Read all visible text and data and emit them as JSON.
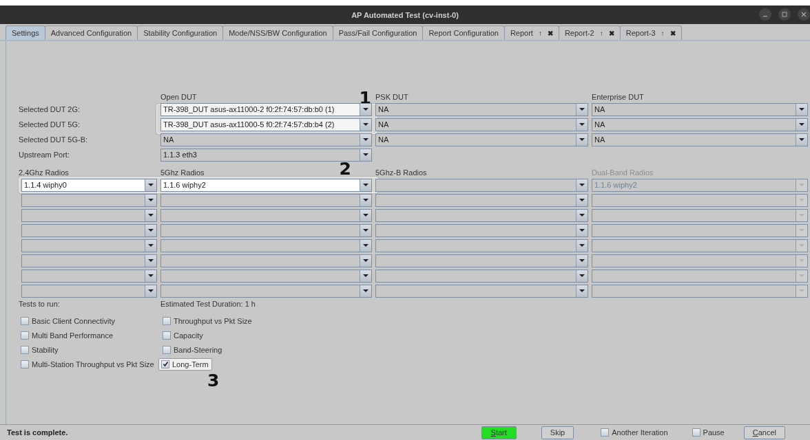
{
  "window": {
    "title": "AP Automated Test  (cv-inst-0)"
  },
  "tabs": [
    {
      "label": "Settings",
      "selected": true
    },
    {
      "label": "Advanced Configuration",
      "selected": false
    },
    {
      "label": "Stability Configuration",
      "selected": false
    },
    {
      "label": "Mode/NSS/BW Configuration",
      "selected": false
    },
    {
      "label": "Pass/Fail Configuration",
      "selected": false
    },
    {
      "label": "Report Configuration",
      "selected": false
    },
    {
      "label": "Report",
      "selected": false,
      "controls": [
        "↑",
        "✖"
      ]
    },
    {
      "label": "Report-2",
      "selected": false,
      "controls": [
        "↑",
        "✖"
      ]
    },
    {
      "label": "Report-3",
      "selected": false,
      "controls": [
        "↑",
        "✖"
      ]
    }
  ],
  "dut": {
    "columns": [
      "Open DUT",
      "PSK DUT",
      "Enterprise DUT"
    ],
    "rows": [
      {
        "label": "Selected DUT 2G:",
        "fields": [
          {
            "value": "TR-398_DUT asus-ax11000-2 f0:2f:74:57:db:b0 (1)",
            "highlighted": true
          },
          {
            "value": "NA"
          },
          {
            "value": "NA"
          }
        ]
      },
      {
        "label": "Selected DUT 5G:",
        "fields": [
          {
            "value": "TR-398_DUT asus-ax11000-5 f0:2f:74:57:db:b4 (2)",
            "highlighted": true
          },
          {
            "value": "NA"
          },
          {
            "value": "NA"
          }
        ]
      },
      {
        "label": "Selected DUT 5G-B:",
        "fields": [
          {
            "value": "NA"
          },
          {
            "value": "NA"
          },
          {
            "value": "NA"
          }
        ]
      },
      {
        "label": "Upstream Port:",
        "fields": [
          {
            "value": "1.1.3 eth3"
          }
        ]
      }
    ],
    "callout": "1"
  },
  "radios": {
    "columns": [
      {
        "label": "2.4Ghz Radios",
        "disabled": false
      },
      {
        "label": "5Ghz Radios",
        "disabled": false
      },
      {
        "label": "5Ghz-B Radios",
        "disabled": false
      },
      {
        "label": "Dual-Band Radios",
        "disabled": true
      }
    ],
    "rows": [
      [
        {
          "value": "1.1.4 wiphy0",
          "highlighted": true
        },
        {
          "value": "1.1.6 wiphy2",
          "highlighted": true
        },
        {},
        {
          "value": "1.1.6 wiphy2"
        }
      ],
      [
        {},
        {},
        {},
        {}
      ],
      [
        {},
        {},
        {},
        {}
      ],
      [
        {},
        {},
        {},
        {}
      ],
      [
        {},
        {},
        {},
        {}
      ],
      [
        {},
        {},
        {},
        {}
      ],
      [
        {},
        {},
        {},
        {}
      ],
      [
        {},
        {},
        {},
        {}
      ]
    ],
    "callout": "2"
  },
  "tests": {
    "label": "Tests to run:",
    "duration": "Estimated Test Duration: 1 h",
    "items": [
      {
        "label": "Basic Client Connectivity",
        "checked": false
      },
      {
        "label": "Throughput vs Pkt Size",
        "checked": false
      },
      {
        "label": "Multi Band Performance",
        "checked": false
      },
      {
        "label": "Capacity",
        "checked": false
      },
      {
        "label": "Stability",
        "checked": false
      },
      {
        "label": "Band-Steering",
        "checked": false
      },
      {
        "label": "Multi-Station Throughput vs Pkt Size",
        "checked": false
      },
      {
        "label": "Long-Term",
        "checked": true,
        "callout": "3"
      }
    ]
  },
  "status_bar": {
    "message": "Test is complete.",
    "controls": [
      {
        "kind": "button",
        "label": "Start",
        "primary": true,
        "underline_first": true
      },
      {
        "kind": "button",
        "label": "Skip",
        "primary": false,
        "underline_first": false
      },
      {
        "kind": "checkbox",
        "label": "Another Iteration",
        "checked": false
      },
      {
        "kind": "checkbox",
        "label": "Pause",
        "checked": false
      },
      {
        "kind": "button",
        "label": "Cancel",
        "primary": false,
        "underline_first": true
      }
    ]
  }
}
